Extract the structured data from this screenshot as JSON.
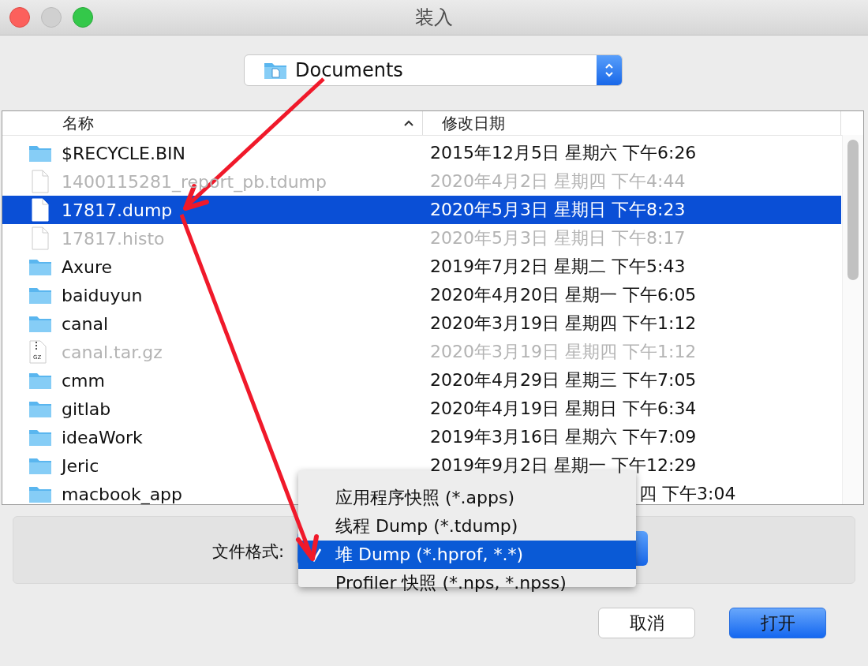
{
  "window": {
    "title": "装入"
  },
  "location": {
    "label": "Documents"
  },
  "table": {
    "columns": [
      {
        "label": "名称",
        "sorted": true
      },
      {
        "label": "修改日期",
        "sorted": false
      }
    ],
    "rows": [
      {
        "kind": "folder",
        "name": "$RECYCLE.BIN",
        "date": "2015年12月5日 星期六 下午6:26",
        "dimmed": false,
        "selected": false,
        "covered": false
      },
      {
        "kind": "file",
        "name": "1400115281_report_pb.tdump",
        "date": "2020年4月2日 星期四 下午4:44",
        "dimmed": true,
        "selected": false,
        "covered": false
      },
      {
        "kind": "file",
        "name": "17817.dump",
        "date": "2020年5月3日 星期日 下午8:23",
        "dimmed": false,
        "selected": true,
        "covered": false
      },
      {
        "kind": "file",
        "name": "17817.histo",
        "date": "2020年5月3日 星期日 下午8:17",
        "dimmed": true,
        "selected": false,
        "covered": false
      },
      {
        "kind": "folder",
        "name": "Axure",
        "date": "2019年7月2日 星期二 下午5:43",
        "dimmed": false,
        "selected": false,
        "covered": false
      },
      {
        "kind": "folder",
        "name": "baiduyun",
        "date": "2020年4月20日 星期一 下午6:05",
        "dimmed": false,
        "selected": false,
        "covered": false
      },
      {
        "kind": "folder",
        "name": "canal",
        "date": "2020年3月19日 星期四 下午1:12",
        "dimmed": false,
        "selected": false,
        "covered": false
      },
      {
        "kind": "archive",
        "name": "canal.tar.gz",
        "date": "2020年3月19日 星期四 下午1:12",
        "dimmed": true,
        "selected": false,
        "covered": false,
        "badge": "GZ"
      },
      {
        "kind": "folder",
        "name": "cmm",
        "date": "2020年4月29日 星期三 下午7:05",
        "dimmed": false,
        "selected": false,
        "covered": false
      },
      {
        "kind": "folder",
        "name": "gitlab",
        "date": "2020年4月19日 星期日 下午6:34",
        "dimmed": false,
        "selected": false,
        "covered": false
      },
      {
        "kind": "folder",
        "name": "ideaWork",
        "date": "2019年3月16日 星期六 下午7:09",
        "dimmed": false,
        "selected": false,
        "covered": false
      },
      {
        "kind": "folder",
        "name": "Jeric",
        "date": "2019年9月2日 星期一 下午12:29",
        "dimmed": false,
        "selected": false,
        "covered": false
      },
      {
        "kind": "folder",
        "name": "macbook_app",
        "date": "四 下午3:04",
        "dimmed": false,
        "selected": false,
        "covered": true
      }
    ]
  },
  "format": {
    "label": "文件格式:",
    "menu": [
      {
        "label": "应用程序快照 (*.apps)",
        "selected": false
      },
      {
        "label": "线程 Dump (*.tdump)",
        "selected": false
      },
      {
        "label": "堆 Dump (*.hprof, *.*)",
        "selected": true
      },
      {
        "label": "Profiler 快照 (*.nps, *.npss)",
        "selected": false
      }
    ]
  },
  "buttons": [
    {
      "label": "取消",
      "kind": "cancel"
    },
    {
      "label": "打开",
      "kind": "default"
    }
  ]
}
